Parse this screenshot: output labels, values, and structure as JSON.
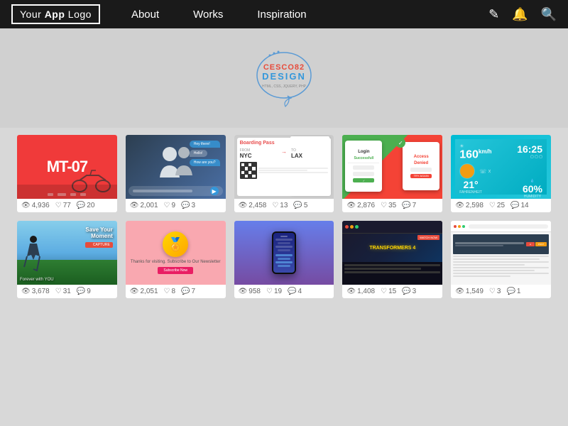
{
  "nav": {
    "logo_plain": "Your ",
    "logo_bold": "App",
    "logo_rest": " Logo",
    "links": [
      "About",
      "Works",
      "Inspiration"
    ],
    "icons": [
      "user",
      "bell",
      "search"
    ]
  },
  "brand": {
    "name": "CESCO82",
    "sub": "DESIGN",
    "tagline": "HTML, CSS, JQUERY, PHP"
  },
  "grid": [
    {
      "rows": [
        {
          "cards": [
            {
              "id": "mt07",
              "views": "4,936",
              "likes": "77",
              "comments": "20"
            },
            {
              "id": "chat",
              "views": "2,001",
              "likes": "9",
              "comments": "3"
            },
            {
              "id": "boarding",
              "views": "2,458",
              "likes": "13",
              "comments": "5"
            },
            {
              "id": "login",
              "views": "2,876",
              "likes": "35",
              "comments": "7"
            },
            {
              "id": "weather",
              "views": "2,598",
              "likes": "25",
              "comments": "14"
            }
          ]
        },
        {
          "cards": [
            {
              "id": "action",
              "views": "3,678",
              "likes": "31",
              "comments": "9"
            },
            {
              "id": "award",
              "views": "2,051",
              "likes": "8",
              "comments": "7"
            },
            {
              "id": "phone",
              "views": "958",
              "likes": "19",
              "comments": "4"
            },
            {
              "id": "transformers",
              "views": "1,408",
              "likes": "15",
              "comments": "3"
            },
            {
              "id": "blog",
              "views": "1,549",
              "likes": "3",
              "comments": "1"
            }
          ]
        }
      ]
    }
  ]
}
